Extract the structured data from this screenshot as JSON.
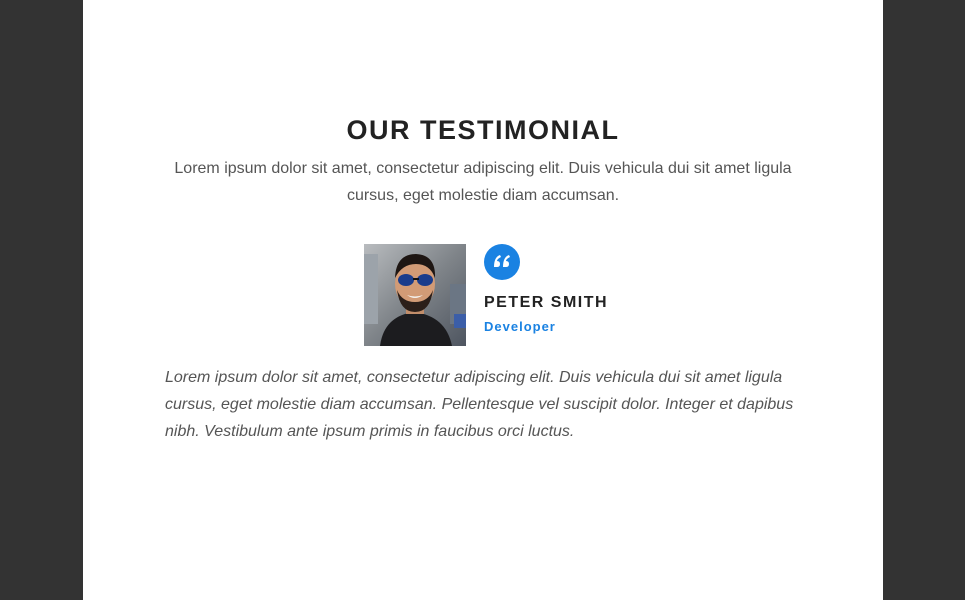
{
  "testimonial": {
    "title": "OUR TESTIMONIAL",
    "subtitle": "Lorem ipsum dolor sit amet, consectetur adipiscing elit. Duis vehicula dui sit amet ligula cursus, eget molestie diam accumsan.",
    "person": {
      "name": "PETER SMITH",
      "role": "Developer"
    },
    "quote": "Lorem ipsum dolor sit amet, consectetur adipiscing elit. Duis vehicula dui sit amet ligula cursus, eget molestie diam accumsan. Pellentesque vel suscipit dolor. Integer et dapibus nibh. Vestibulum ante ipsum primis in faucibus orci luctus.",
    "quote_icon": "quote-icon"
  },
  "colors": {
    "background": "#333333",
    "card": "#ffffff",
    "accent": "#1a82e2",
    "heading": "#222222",
    "body_text": "#555555"
  }
}
